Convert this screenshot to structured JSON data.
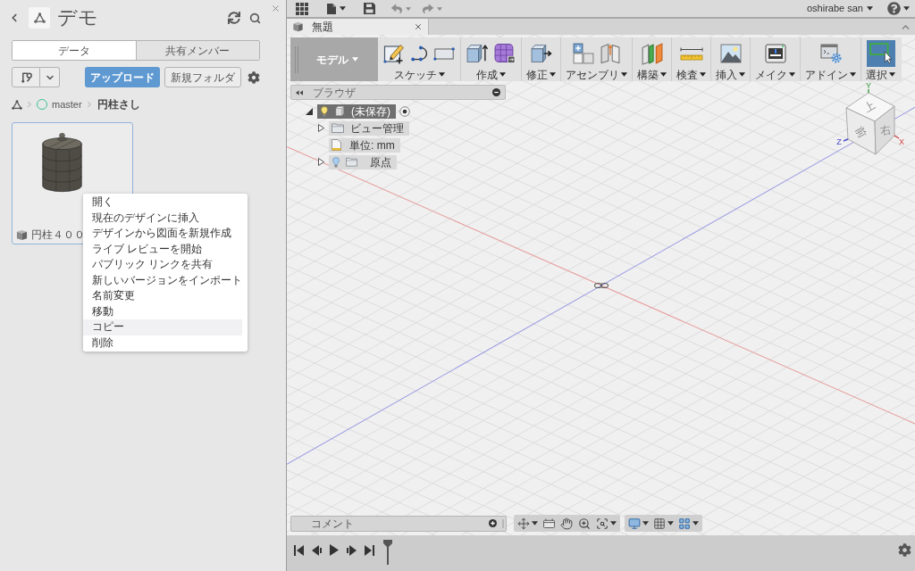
{
  "data_panel": {
    "title": "デモ",
    "tabs": [
      {
        "label": "データ",
        "selected": true
      },
      {
        "label": "共有メンバー",
        "selected": false
      }
    ],
    "upload_button": "アップロード",
    "new_folder_button": "新規フォルダ",
    "breadcrumb": {
      "branch": "master",
      "folder": "円柱さし"
    },
    "files": [
      {
        "name": "円柱４００",
        "selected": true
      }
    ]
  },
  "context_menu": [
    {
      "label": "開く",
      "selected": false
    },
    {
      "label": "現在のデザインに挿入",
      "selected": false
    },
    {
      "label": "デザインから図面を新規作成",
      "selected": false
    },
    {
      "label": "ライブ レビューを開始",
      "selected": false
    },
    {
      "label": "パブリック リンクを共有",
      "selected": false
    },
    {
      "label": "新しいバージョンをインポート",
      "selected": false
    },
    {
      "label": "名前変更",
      "selected": false
    },
    {
      "label": "移動",
      "selected": false
    },
    {
      "label": "コピー",
      "selected": true
    },
    {
      "label": "削除",
      "selected": false
    }
  ],
  "app_bar": {
    "undo": {
      "disabled": true
    },
    "redo": {
      "disabled": true
    },
    "user": "oshirabe san"
  },
  "document_tabs": [
    {
      "title": "無題",
      "selected": true
    }
  ],
  "toolbar": {
    "workspace": "モデル",
    "groups": [
      {
        "label": "スケッチ",
        "selected": false
      },
      {
        "label": "作成",
        "selected": false
      },
      {
        "label": "修正",
        "selected": false
      },
      {
        "label": "アセンブリ",
        "selected": false
      },
      {
        "label": "構築",
        "selected": false
      },
      {
        "label": "検査",
        "selected": false
      },
      {
        "label": "挿入",
        "selected": false
      },
      {
        "label": "メイク",
        "selected": false
      },
      {
        "label": "アドイン",
        "selected": false
      },
      {
        "label": "選択",
        "selected": true
      }
    ]
  },
  "browser": {
    "title": "ブラウザ",
    "tree": [
      {
        "label": "(未保存)",
        "kind": "component",
        "selected": true,
        "expanded": true,
        "visible": true,
        "children": [
          {
            "label": "ビュー管理",
            "kind": "folder",
            "selected": false,
            "expanded": false
          },
          {
            "label": "単位: mm",
            "kind": "units",
            "selected": false
          },
          {
            "label": "原点",
            "kind": "origin",
            "selected": false,
            "expanded": false,
            "visible": false
          }
        ]
      }
    ]
  },
  "view_cube": {
    "faces": [
      "上",
      "前",
      "右"
    ],
    "axes": [
      "Y",
      "Z",
      "X"
    ]
  },
  "comments": {
    "title": "コメント"
  }
}
